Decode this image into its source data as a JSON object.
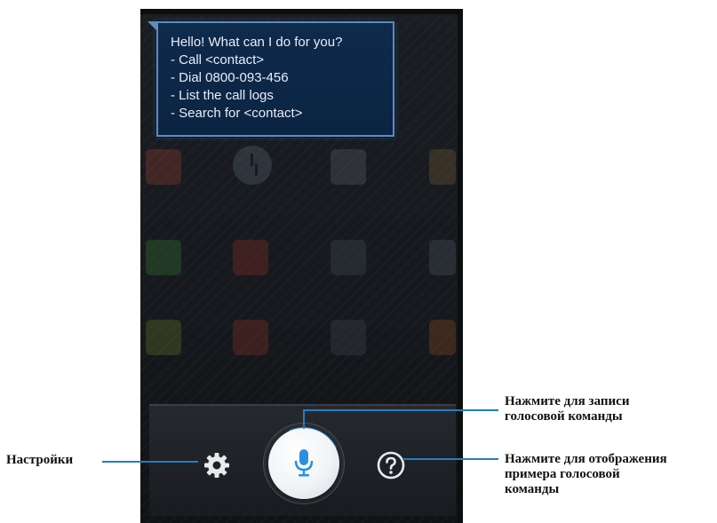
{
  "speech_bubble": {
    "lines": [
      "Hello! What can I do for you?",
      "- Call <contact>",
      "- Dial 0800-093-456",
      "- List the call logs",
      "- Search for <contact>"
    ]
  },
  "callouts": {
    "settings": "Настройки",
    "record_line1": "Нажмите для записи",
    "record_line2": "голосовой команды",
    "example_line1": "Нажмите для отображения",
    "example_line2": "примера голосовой",
    "example_line3": "команды"
  },
  "colors": {
    "accent": "#1f7fc4",
    "bubble_bg": "#0f2a4c",
    "bubble_border": "#5f8bbd",
    "mic_blue": "#2a8fe0"
  },
  "icons": {
    "settings": "gear-icon",
    "mic": "microphone-icon",
    "help": "question-icon"
  }
}
